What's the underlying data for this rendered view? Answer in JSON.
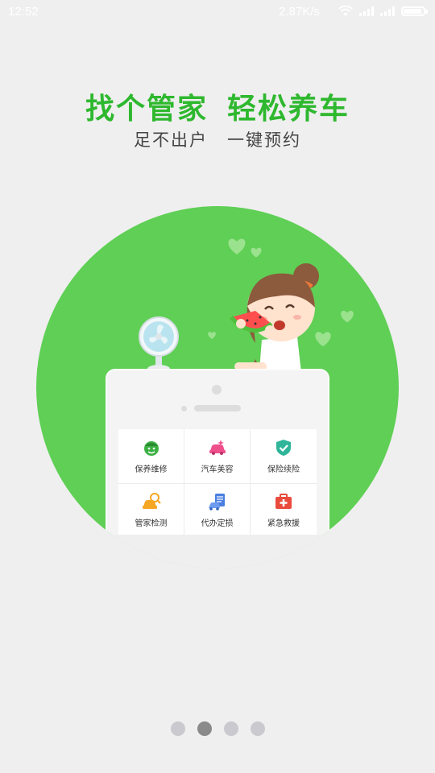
{
  "status": {
    "time": "12:52",
    "net_speed": "2.87K/s",
    "battery_level": 0.9,
    "icons": [
      "wifi-icon",
      "signal-icon",
      "signal-icon",
      "battery-icon"
    ]
  },
  "headline": {
    "part1": "找个管家",
    "part2": "轻松养车"
  },
  "subline": {
    "part1": "足不出户",
    "part2": "一键预约"
  },
  "colors": {
    "brand_green": "#2eb82e",
    "circle_green": "#5fcf55",
    "background": "#efefef"
  },
  "services": [
    {
      "label": "保养维修",
      "icon": "mechanic-icon",
      "color": "#3cb043"
    },
    {
      "label": "汽车美容",
      "icon": "car-wash-icon",
      "color": "#ef4f8b"
    },
    {
      "label": "保险续险",
      "icon": "shield-check-icon",
      "color": "#2fb59a"
    },
    {
      "label": "管家检测",
      "icon": "car-inspection-icon",
      "color": "#f5a623"
    },
    {
      "label": "代办定损",
      "icon": "document-car-icon",
      "color": "#4a7fe0"
    },
    {
      "label": "紧急救援",
      "icon": "first-aid-icon",
      "color": "#e94b3c"
    }
  ],
  "pager": {
    "count": 4,
    "active_index": 1
  }
}
